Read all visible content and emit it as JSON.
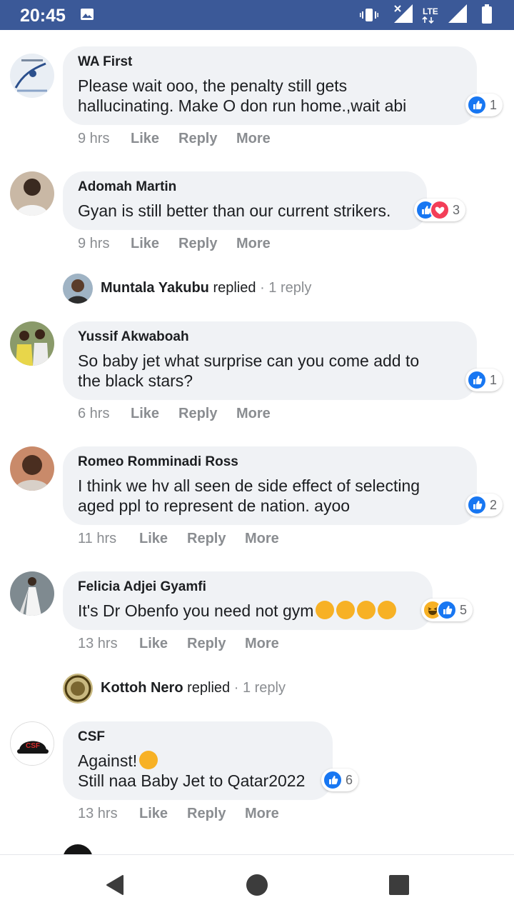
{
  "status_bar": {
    "time": "20:45",
    "network": "LTE"
  },
  "labels": {
    "like": "Like",
    "reply": "Reply",
    "more": "More",
    "replied": "replied",
    "sep": "·"
  },
  "colors": {
    "status_bar": "#3b5998",
    "like_blue": "#1877f2",
    "love_red": "#f33e58",
    "haha_yellow": "#f7b125",
    "bubble": "#f0f2f5",
    "meta_gray": "#8a8d91"
  },
  "comments": [
    {
      "name": "WA First",
      "text": "Please wait ooo, the penalty still gets\nhallucinating. Make O don run home.,wait abi",
      "time": "9 hrs",
      "reactions": [
        "like"
      ],
      "count": "1"
    },
    {
      "name": "Adomah Martin",
      "text": "Gyan is still better than our current strikers.",
      "time": "9 hrs",
      "reactions": [
        "like",
        "love"
      ],
      "count": "3"
    },
    {
      "name": "Yussif Akwaboah",
      "text": "So baby jet what surprise can you come add to\nthe black stars?",
      "time": "6 hrs",
      "reactions": [
        "like"
      ],
      "count": "1"
    },
    {
      "name": "Romeo Romminadi Ross",
      "text": "I think we hv all seen de side effect of selecting\naged ppl to represent de nation. ayoo",
      "time": "11 hrs",
      "reactions": [
        "like"
      ],
      "count": "2"
    },
    {
      "name": "Felicia Adjei Gyamfi",
      "text": "It's Dr Obenfo you need not gym",
      "time": "13 hrs",
      "reactions": [
        "haha",
        "like"
      ],
      "count": "5"
    },
    {
      "name": "CSF",
      "text": "Against!",
      "text2": "Still naa Baby Jet to Qatar2022",
      "time": "13 hrs",
      "reactions": [
        "like"
      ],
      "count": "6"
    }
  ],
  "replies": [
    {
      "name": "Muntala Yakubu",
      "summary": "1 reply"
    },
    {
      "name": "Kottoh Nero",
      "summary": "1 reply"
    }
  ],
  "avatar_text": {
    "csf": "CSF"
  }
}
